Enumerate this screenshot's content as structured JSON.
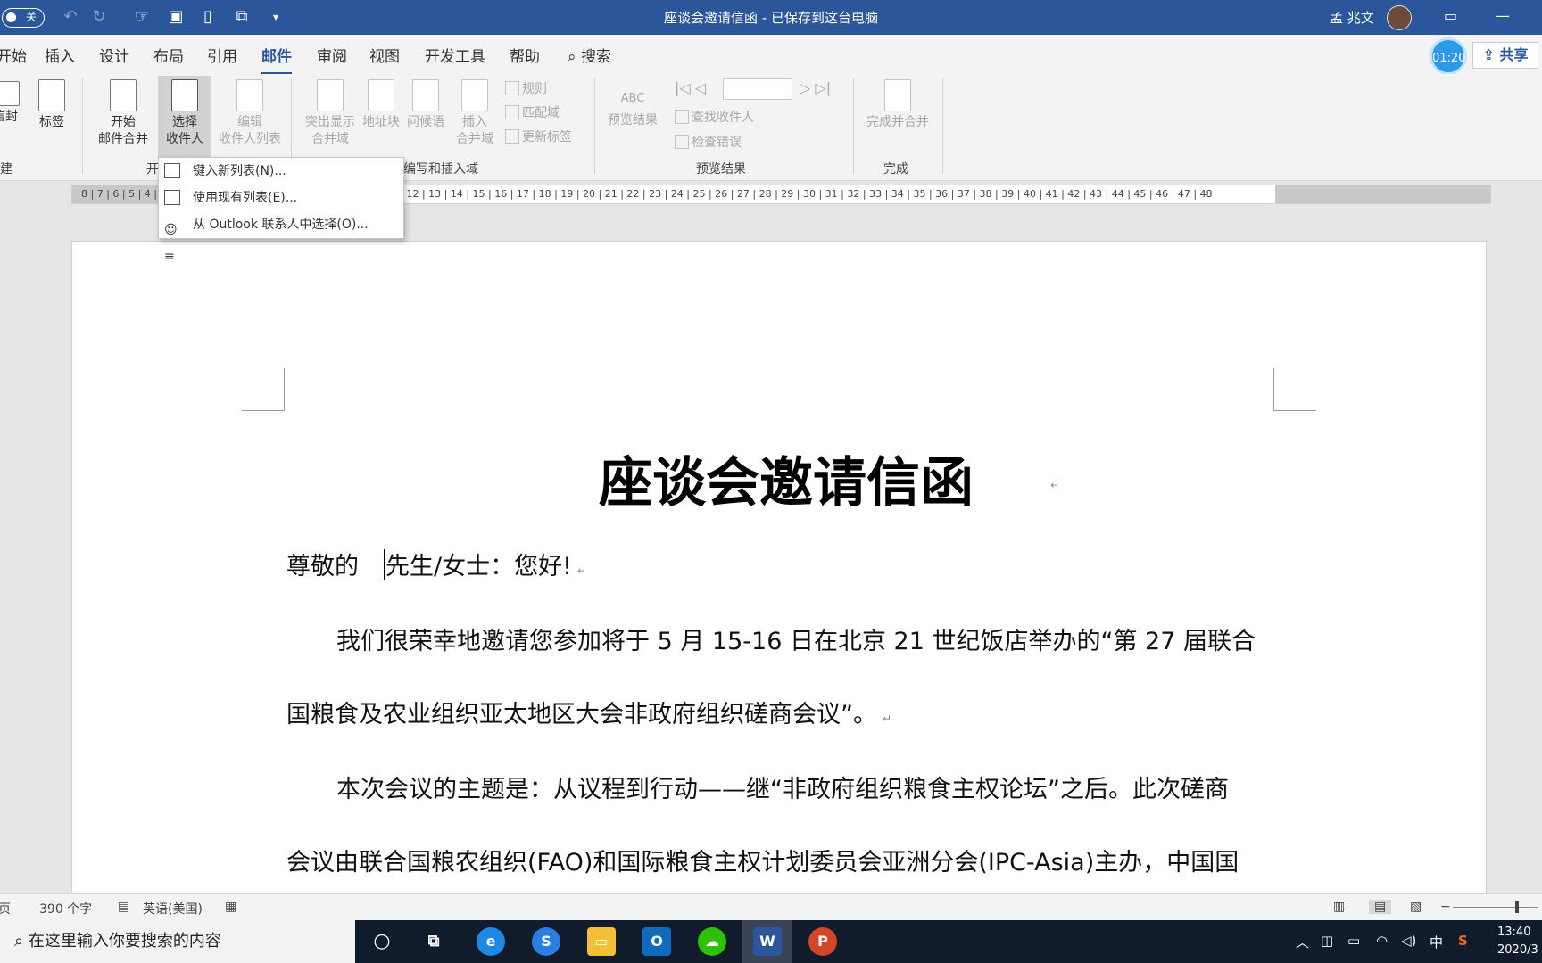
{
  "titlebar": {
    "autosave_label": "关",
    "title": "座谈会邀请信函 - 已保存到这台电脑",
    "user": "孟 兆文"
  },
  "tabs": [
    "开始",
    "插入",
    "设计",
    "布局",
    "引用",
    "邮件",
    "审阅",
    "视图",
    "开发工具",
    "帮助"
  ],
  "active_tab": "邮件",
  "search_label": "搜索",
  "timer": "01:20",
  "share_label": "共享",
  "ribbon": {
    "envelope": "信封",
    "labels": "标签",
    "create_group": "建",
    "start_merge": [
      "开始",
      "邮件合并"
    ],
    "select_recipients": [
      "选择",
      "收件人"
    ],
    "edit_recipients": [
      "编辑",
      "收件人列表"
    ],
    "start_group": "开",
    "highlight_fields": [
      "突出显示",
      "合并域"
    ],
    "address_block": "地址块",
    "greeting_line": "问候语",
    "insert_field": [
      "插入",
      "合并域"
    ],
    "rules": "规则",
    "match_fields": "匹配域",
    "update_labels": "更新标签",
    "write_group": "编写和插入域",
    "preview_results": "预览结果",
    "preview_abc": "ABC",
    "find_recipient": "查找收件人",
    "check_errors": "检查错误",
    "preview_group": "预览结果",
    "finish_merge": "完成并合并",
    "finish_group": "完成"
  },
  "dropdown": [
    "键入新列表(N)...",
    "使用现有列表(E)...",
    "从 Outlook 联系人中选择(O)..."
  ],
  "ruler_numbers": "8 | 7 | 6 | 5 | 4 | 3 | 2 | 1 | · | 1 | 2 | 3 | 4 | 5 | 6 | 7 | 8 | 9 | 10 | 11 | 12 | 13 | 14 | 15 | 16 | 17 | 18 | 19 | 20 | 21 | 22 | 23 | 24 | 25 | 26 | 27 | 28 | 29 | 30 | 31 | 32 | 33 | 34 | 35 | 36 | 37 | 38 | 39 | 40 | 41 | 42 | 43 | 44 | 45 | 46 | 47 | 48",
  "document": {
    "title": "座谈会邀请信函",
    "salutation_a": "尊敬的",
    "salutation_b": "先生/女士：您好!",
    "p1_line1": "我们很荣幸地邀请您参加将于 5 月 15-16 日在北京 21 世纪饭店举办的“第 27 届联合",
    "p1_line2": "国粮食及农业组织亚太地区大会非政府组织磋商会议”。",
    "p2_line1": "本次会议的主题是：从议程到行动——继“非政府组织粮食主权论坛”之后。此次磋商",
    "p2_line2": "会议由联合国粮农组织(FAO)和国际粮食主权计划委员会亚洲分会(IPC-Asia)主办，中国国",
    "para_mark": "↵"
  },
  "status": {
    "page": "页",
    "words": "390 个字",
    "language": "英语(美国)"
  },
  "taskbar": {
    "search_placeholder": "在这里输入你要搜索的内容",
    "ime": "中",
    "time": "13:40",
    "date": "2020/3"
  },
  "colors": {
    "word_blue": "#2b579a",
    "ribbon_bg": "#f3f3f3",
    "taskbar": "#101b2c"
  }
}
